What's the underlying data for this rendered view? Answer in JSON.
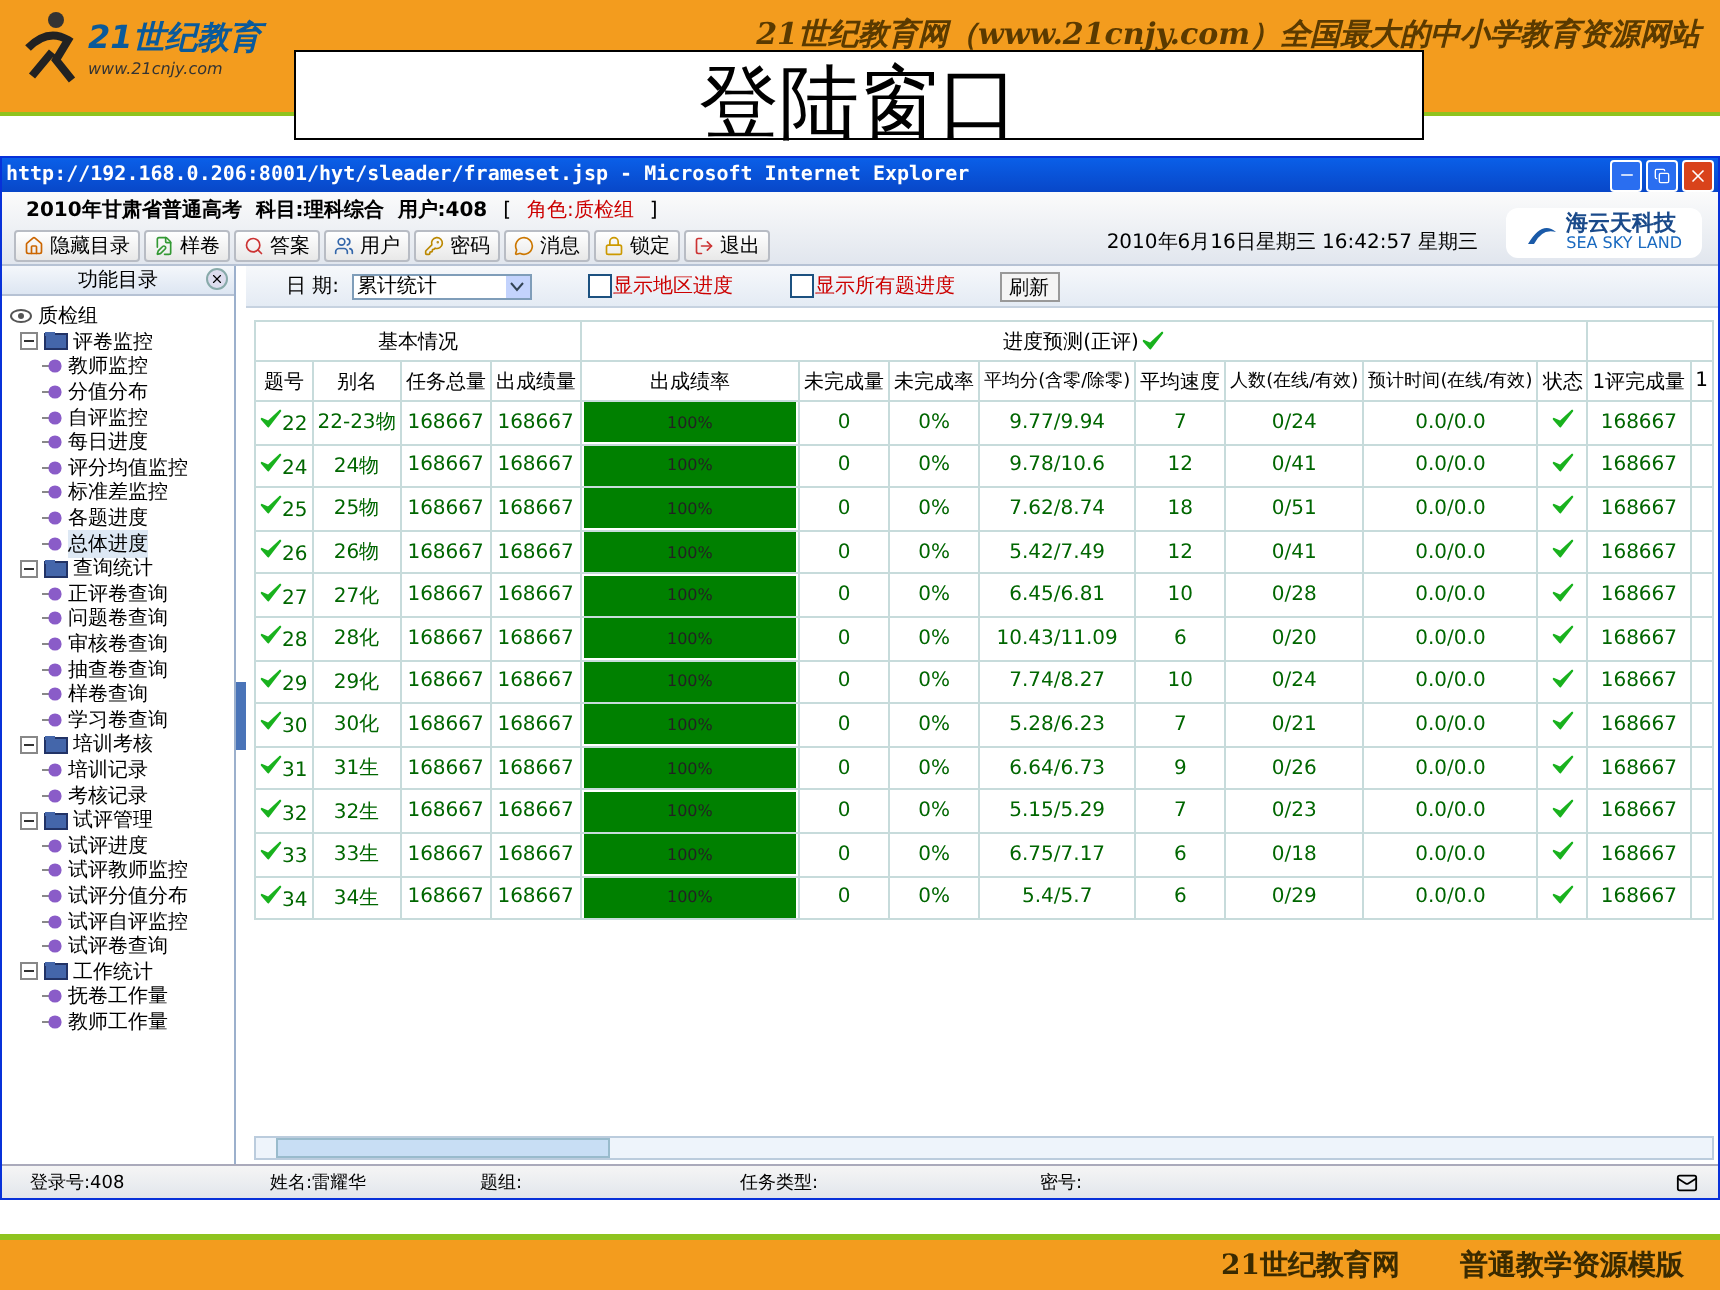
{
  "banner": {
    "logo_text": "21世纪教育",
    "logo_url": "www.21cnjy.com",
    "slogan": "21世纪教育网（www.21cnjy.com）全国最大的中小学教育资源网站"
  },
  "slide_title": "登陆窗口",
  "window": {
    "title": "http://192.168.0.206:8001/hyt/sleader/frameset.jsp - Microsoft Internet Explorer"
  },
  "app_header": {
    "info": "2010年甘肃省普通高考  科目:理科综合  用户:408",
    "bracket_left": "[",
    "role": "角色:质检组",
    "bracket_right": "]",
    "datetime": "2010年6月16日星期三  16:42:57 星期三",
    "brand": "海云天科技",
    "brand_en": "SEA SKY LAND"
  },
  "toolbar": [
    {
      "label": "隐藏目录"
    },
    {
      "label": "样卷"
    },
    {
      "label": "答案"
    },
    {
      "label": "用户"
    },
    {
      "label": "密码"
    },
    {
      "label": "消息"
    },
    {
      "label": "锁定"
    },
    {
      "label": "退出"
    }
  ],
  "sidebar": {
    "title": "功能目录",
    "root": "质检组",
    "groups": [
      {
        "label": "评卷监控",
        "expanded": true,
        "children": [
          {
            "label": "教师监控",
            "selected": false
          },
          {
            "label": "分值分布",
            "selected": false
          },
          {
            "label": "自评监控",
            "selected": false
          },
          {
            "label": "每日进度",
            "selected": false
          },
          {
            "label": "评分均值监控",
            "selected": false
          },
          {
            "label": "标准差监控",
            "selected": false
          },
          {
            "label": "各题进度",
            "selected": false
          },
          {
            "label": "总体进度",
            "selected": true
          }
        ]
      },
      {
        "label": "查询统计",
        "expanded": true,
        "children": [
          {
            "label": "正评卷查询",
            "selected": false
          },
          {
            "label": "问题卷查询",
            "selected": false
          },
          {
            "label": "审核卷查询",
            "selected": false
          },
          {
            "label": "抽查卷查询",
            "selected": false
          },
          {
            "label": "样卷查询",
            "selected": false
          },
          {
            "label": "学习卷查询",
            "selected": false
          }
        ]
      },
      {
        "label": "培训考核",
        "expanded": true,
        "children": [
          {
            "label": "培训记录",
            "selected": false
          },
          {
            "label": "考核记录",
            "selected": false
          }
        ]
      },
      {
        "label": "试评管理",
        "expanded": true,
        "children": [
          {
            "label": "试评进度",
            "selected": false
          },
          {
            "label": "试评教师监控",
            "selected": false
          },
          {
            "label": "试评分值分布",
            "selected": false
          },
          {
            "label": "试评自评监控",
            "selected": false
          },
          {
            "label": "试评卷查询",
            "selected": false
          }
        ]
      },
      {
        "label": "工作统计",
        "expanded": true,
        "children": [
          {
            "label": "抚卷工作量",
            "selected": false
          },
          {
            "label": "教师工作量",
            "selected": false
          }
        ]
      }
    ]
  },
  "filter": {
    "date_label": "日 期:",
    "date_value": "累计统计",
    "options": [
      {
        "label": "显示地区进度",
        "checked": false
      },
      {
        "label": "显示所有题进度",
        "checked": false
      }
    ],
    "refresh": "刷新"
  },
  "table": {
    "groups": [
      {
        "label": "基本情况",
        "columns": [
          "题号",
          "别名",
          "任务总量",
          "出成绩量"
        ]
      },
      {
        "label": "进度预测(正评)",
        "columns": [
          "出成绩率",
          "未完成量",
          "未完成率",
          "平均分(含零/除零)",
          "平均速度",
          "人数(在线/有效)",
          "预计时间(在线/有效)",
          "状态"
        ]
      },
      {
        "columns": [
          "1评完成量",
          "1"
        ]
      }
    ],
    "rows": [
      {
        "no": "22",
        "done": true,
        "alias": "22-23物",
        "total": "168667",
        "scored": "168667",
        "rate": "100%",
        "level": 1,
        "unfinished": "0",
        "unfinished_rate": "0%",
        "avg": "9.77/9.94",
        "speed": "7",
        "people": "0/24",
        "eta": "0.0/0.0",
        "ok": true,
        "first": "168667"
      },
      {
        "no": "24",
        "done": true,
        "alias": "24物",
        "total": "168667",
        "scored": "168667",
        "rate": "100%",
        "level": 1,
        "unfinished": "0",
        "unfinished_rate": "0%",
        "avg": "9.78/10.6",
        "speed": "12",
        "people": "0/41",
        "eta": "0.0/0.0",
        "ok": true,
        "first": "168667"
      },
      {
        "no": "25",
        "done": true,
        "alias": "25物",
        "total": "168667",
        "scored": "168667",
        "rate": "100%",
        "level": 1,
        "unfinished": "0",
        "unfinished_rate": "0%",
        "avg": "7.62/8.74",
        "speed": "18",
        "people": "0/51",
        "eta": "0.0/0.0",
        "ok": true,
        "first": "168667"
      },
      {
        "no": "26",
        "done": true,
        "alias": "26物",
        "total": "168667",
        "scored": "168667",
        "rate": "100%",
        "level": 1,
        "unfinished": "0",
        "unfinished_rate": "0%",
        "avg": "5.42/7.49",
        "speed": "12",
        "people": "0/41",
        "eta": "0.0/0.0",
        "ok": true,
        "first": "168667"
      },
      {
        "no": "27",
        "done": true,
        "alias": "27化",
        "total": "168667",
        "scored": "168667",
        "rate": "100%",
        "level": 1,
        "unfinished": "0",
        "unfinished_rate": "0%",
        "avg": "6.45/6.81",
        "speed": "10",
        "people": "0/28",
        "eta": "0.0/0.0",
        "ok": true,
        "first": "168667"
      },
      {
        "no": "28",
        "done": true,
        "alias": "28化",
        "total": "168667",
        "scored": "168667",
        "rate": "100%",
        "level": 1,
        "unfinished": "0",
        "unfinished_rate": "0%",
        "avg": "10.43/11.09",
        "speed": "6",
        "people": "0/20",
        "eta": "0.0/0.0",
        "ok": true,
        "first": "168667"
      },
      {
        "no": "29",
        "done": true,
        "alias": "29化",
        "total": "168667",
        "scored": "168667",
        "rate": "100%",
        "level": 1,
        "unfinished": "0",
        "unfinished_rate": "0%",
        "avg": "7.74/8.27",
        "speed": "10",
        "people": "0/24",
        "eta": "0.0/0.0",
        "ok": true,
        "first": "168667"
      },
      {
        "no": "30",
        "done": true,
        "alias": "30化",
        "total": "168667",
        "scored": "168667",
        "rate": "100%",
        "level": 1,
        "unfinished": "0",
        "unfinished_rate": "0%",
        "avg": "5.28/6.23",
        "speed": "7",
        "people": "0/21",
        "eta": "0.0/0.0",
        "ok": true,
        "first": "168667"
      },
      {
        "no": "31",
        "done": true,
        "alias": "31生",
        "total": "168667",
        "scored": "168667",
        "rate": "100%",
        "level": 1,
        "unfinished": "0",
        "unfinished_rate": "0%",
        "avg": "6.64/6.73",
        "speed": "9",
        "people": "0/26",
        "eta": "0.0/0.0",
        "ok": true,
        "first": "168667"
      },
      {
        "no": "32",
        "done": true,
        "alias": "32生",
        "total": "168667",
        "scored": "168667",
        "rate": "100%",
        "level": 1,
        "unfinished": "0",
        "unfinished_rate": "0%",
        "avg": "5.15/5.29",
        "speed": "7",
        "people": "0/23",
        "eta": "0.0/0.0",
        "ok": true,
        "first": "168667"
      },
      {
        "no": "33",
        "done": true,
        "alias": "33生",
        "total": "168667",
        "scored": "168667",
        "rate": "100%",
        "level": 1,
        "unfinished": "0",
        "unfinished_rate": "0%",
        "avg": "6.75/7.17",
        "speed": "6",
        "people": "0/18",
        "eta": "0.0/0.0",
        "ok": true,
        "first": "168667"
      },
      {
        "no": "34",
        "done": true,
        "alias": "34生",
        "total": "168667",
        "scored": "168667",
        "rate": "100%",
        "level": 1,
        "unfinished": "0",
        "unfinished_rate": "0%",
        "avg": "5.4/5.7",
        "speed": "6",
        "people": "0/29",
        "eta": "0.0/0.0",
        "ok": true,
        "first": "168667"
      }
    ]
  },
  "status_bar": [
    "登录号:408",
    "姓名:雷耀华",
    "题组:",
    "任务类型:",
    "密号:"
  ],
  "footer": {
    "site": "21世纪教育网",
    "tagline": "普通教学资源模版"
  }
}
